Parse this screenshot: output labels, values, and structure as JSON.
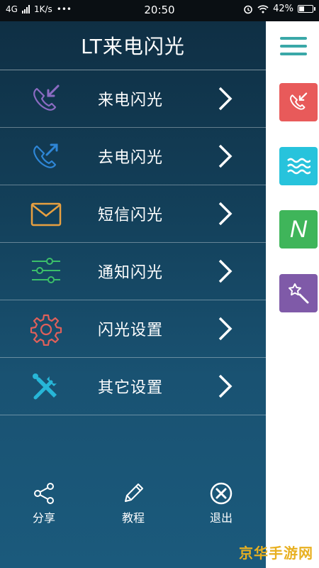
{
  "status_bar": {
    "network": "4G",
    "speed": "1K/s",
    "dots": "•••",
    "time": "20:50",
    "battery": "42%",
    "battery_level": 0.42
  },
  "header": {
    "title": "LT来电闪光"
  },
  "menu": {
    "items": [
      {
        "label": "来电闪光",
        "icon": "incoming-call-icon",
        "color": "#8b6bc2"
      },
      {
        "label": "去电闪光",
        "icon": "outgoing-call-icon",
        "color": "#2e86d6"
      },
      {
        "label": "短信闪光",
        "icon": "envelope-icon",
        "color": "#e8a040"
      },
      {
        "label": "通知闪光",
        "icon": "sliders-icon",
        "color": "#3bbf6a"
      },
      {
        "label": "闪光设置",
        "icon": "gear-icon",
        "color": "#e0605a"
      },
      {
        "label": "其它设置",
        "icon": "tools-icon",
        "color": "#27b6d8"
      }
    ]
  },
  "bottom_bar": {
    "share": "分享",
    "tutorial": "教程",
    "exit": "退出"
  },
  "side_rail": {
    "menu_icon": "hamburger-icon",
    "accent": "#3aa8a8",
    "tiles": [
      {
        "icon": "incoming-call-icon",
        "color": "#e85a5a"
      },
      {
        "icon": "waves-icon",
        "color": "#27c3dc"
      },
      {
        "icon": "n-letter-icon",
        "color": "#3fb55a",
        "text": "N"
      },
      {
        "icon": "magic-wand-icon",
        "color": "#7f5aa8"
      }
    ]
  },
  "watermark": "京华手游网"
}
